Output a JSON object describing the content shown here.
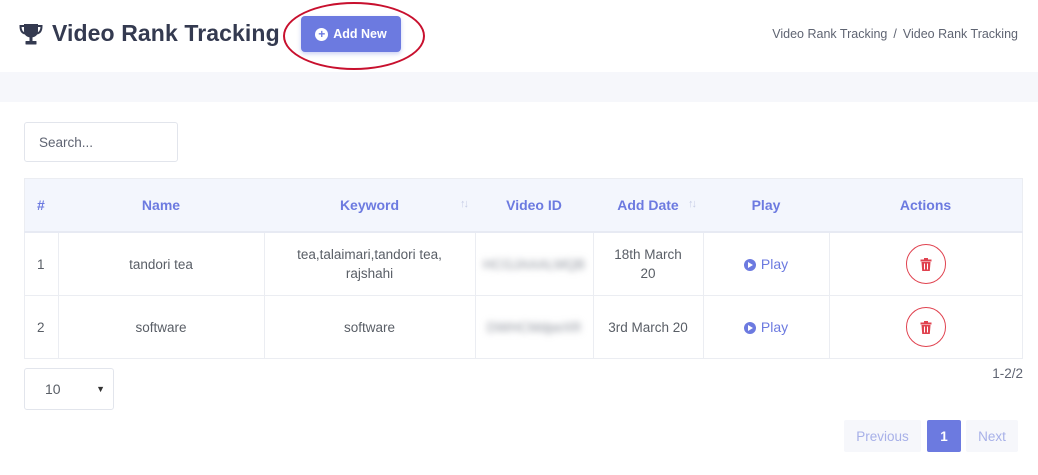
{
  "header": {
    "title": "Video Rank Tracking",
    "add_button_label": "Add New",
    "breadcrumb": [
      "Video Rank Tracking",
      "Video Rank Tracking"
    ],
    "breadcrumb_separator": "/"
  },
  "search": {
    "placeholder": "Search..."
  },
  "table": {
    "columns": [
      "#",
      "Name",
      "Keyword",
      "Video ID",
      "Add Date",
      "Play",
      "Actions"
    ],
    "rows": [
      {
        "index": "1",
        "name": "tandori tea",
        "keyword_line1": "tea,talaimari,tandori tea,",
        "keyword_line2": "rajshahi",
        "video_id": "HCGJAAALMQB",
        "date_line1": "18th March",
        "date_line2": "20",
        "play_label": "Play"
      },
      {
        "index": "2",
        "name": "software",
        "keyword_line1": "software",
        "keyword_line2": "",
        "video_id": "DWHCMdpeXR",
        "date_line1": "3rd March 20",
        "date_line2": "",
        "play_label": "Play"
      }
    ]
  },
  "page_size": {
    "selected": "10"
  },
  "record_count": "1-2/2",
  "pagination": {
    "previous": "Previous",
    "current": "1",
    "next": "Next"
  },
  "colors": {
    "accent": "#6c7ae0",
    "danger": "#e0424f",
    "annotation": "#c8102e"
  },
  "icons": {
    "title": "trophy-icon",
    "add": "plus-circle-icon",
    "play": "play-circle-icon",
    "delete": "trash-icon",
    "select": "caret-down-icon",
    "sort": "sort-arrows-icon"
  }
}
